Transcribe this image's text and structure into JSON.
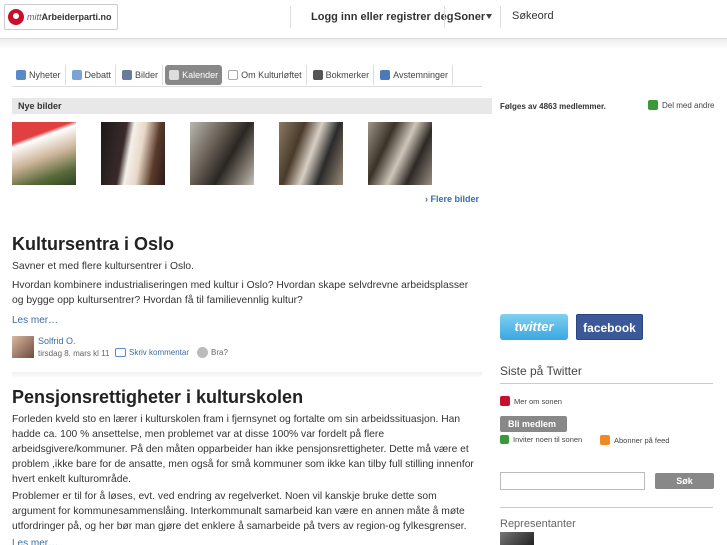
{
  "header": {
    "logo_text_italic": "mitt",
    "logo_text": "Arbeiderparti.no",
    "login": "Logg inn eller registrer deg",
    "soner": "Soner",
    "search": "Søkeord"
  },
  "tabs": [
    {
      "label": "Nyheter",
      "icon_color": "#5a8ac6"
    },
    {
      "label": "Debatt",
      "icon_color": "#7aa3d4"
    },
    {
      "label": "Bilder",
      "icon_color": "#6a7a9a"
    },
    {
      "label": "Kalender",
      "icon_color": "#dddddd"
    },
    {
      "label": "Om Kulturløftet",
      "icon_color": "#bbbbbb"
    },
    {
      "label": "Bokmerker",
      "icon_color": "#555555"
    },
    {
      "label": "Avstemninger",
      "icon_color": "#4a7ab8"
    }
  ],
  "images": {
    "heading": "Nye bilder",
    "more": "Flere bilder"
  },
  "articles": [
    {
      "title": "Kultursentra i Oslo",
      "paragraphs": [
        "Savner et med flere kultursentrer i Oslo.",
        "Hvordan kombinere industrialiseringen med kultur i Oslo? Hvordan skape selvdrevne arbeidsplasser og bygge opp kultursentrer? Hvordan få til familievennlig kultur?"
      ],
      "more": "Les mer…",
      "author": "Solfrid O.",
      "date": "tirsdag 8. mars kl 11",
      "comment": "Skriv kommentar",
      "like": "Bra?"
    },
    {
      "title": "Pensjonsrettigheter i kulturskolen",
      "paragraphs": [
        "Forleden kveld sto en lærer i kulturskolen fram i fjernsynet og fortalte om sin arbeidssituasjon. Han hadde ca. 100 % ansettelse, men problemet var at disse 100% var fordelt på flere arbeidsgivere/kommuner. På den måten opparbeider han ikke pensjonsrettigheter. Dette må være et problem ,ikke bare for de ansatte, men også for små kommuner som ikke kan tilby full stilling innenfor hvert enkelt kulturområde.",
        "Problemer er til for å løses, evt. ved endring av regelverket. Noen vil kanskje bruke dette som argument for kommunesammenslåing. Interkommunalt samarbeid kan være en annen måte å møte utfordringer på, og her bør man gjøre det enklere å samarbeide på tvers av region-og fylkesgrenser."
      ],
      "more": "Les mer…"
    }
  ],
  "sidebar": {
    "followers": "Følges av 4863 medlemmer.",
    "share": "Del med andre",
    "twitter_button": "twitter",
    "facebook_button": "facebook",
    "twitter_heading": "Siste på Twitter",
    "mer_om": "Mer om sonen",
    "bli_medlem": "Bli medlem",
    "inviter": "Inviter noen til sonen",
    "abonner": "Abonner på feed",
    "search_button": "Søk",
    "representanter": "Representanter"
  },
  "colors": {
    "accent_link": "#3a6ea5",
    "brand_red": "#c8102e",
    "facebook": "#3b5998",
    "twitter": "#3aa7e0"
  }
}
